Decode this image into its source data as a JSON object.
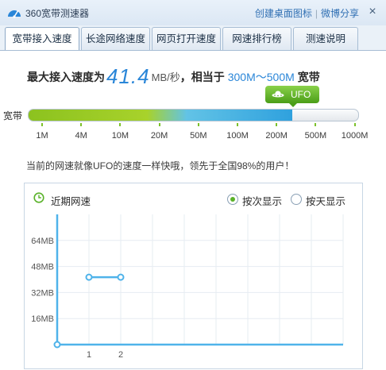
{
  "window": {
    "title": "360宽带测速器",
    "links": [
      "创建桌面图标",
      "微博分享"
    ],
    "close_label": "×"
  },
  "tabs": [
    {
      "label": "宽带接入速度",
      "active": true
    },
    {
      "label": "长途网络速度",
      "active": false
    },
    {
      "label": "网页打开速度",
      "active": false
    },
    {
      "label": "网速排行榜",
      "active": false
    },
    {
      "label": "测速说明",
      "active": false
    }
  ],
  "result": {
    "prefix": "最大接入速度为",
    "speed": "41.4",
    "unit": "MB/秒",
    "middle": "，相当于",
    "bandwidth": "300M～500M",
    "suffix": "宽带"
  },
  "badge": {
    "label": "UFO"
  },
  "bandwidth_bar": {
    "label": "宽带",
    "fill_fraction": 0.8,
    "ticks": [
      "1M",
      "4M",
      "10M",
      "20M",
      "50M",
      "100M",
      "200M",
      "500M",
      "1000M"
    ]
  },
  "compare_text": "当前的网速就像UFO的速度一样快哦，领先于全国98%的用户！",
  "recent": {
    "title": "近期网速",
    "options": [
      {
        "label": "按次显示",
        "selected": true
      },
      {
        "label": "按天显示",
        "selected": false
      }
    ]
  },
  "chart_data": {
    "type": "line",
    "x": [
      0,
      1,
      2
    ],
    "xticks": [
      "1",
      "2"
    ],
    "series": [
      {
        "values": [
          0,
          41.4,
          41.4
        ]
      }
    ],
    "ylabels": [
      "16MB",
      "32MB",
      "48MB",
      "64MB"
    ],
    "yticks": [
      16,
      32,
      48,
      64
    ],
    "ylim": [
      0,
      80
    ],
    "xlim": [
      0,
      9
    ],
    "grid": true,
    "line_color": "#4fb3ea"
  },
  "colors": {
    "accent": "#2a86d8",
    "green": "#5ab22a",
    "title_link": "#2f6fb3"
  }
}
